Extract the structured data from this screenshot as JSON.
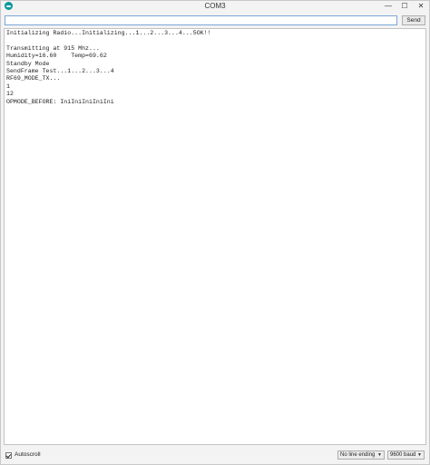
{
  "window": {
    "title": "COM3",
    "minimize_glyph": "—",
    "maximize_glyph": "☐",
    "close_glyph": "✕"
  },
  "input": {
    "value": "",
    "send_label": "Send"
  },
  "output": {
    "lines": [
      "Initializing Radio...Initializing...1...2...3...4...5OK!!",
      "",
      "Transmitting at 915 Mhz...",
      "Humidity=16.60    Temp=69.62",
      "Standby Mode",
      "SendFrame Test...1...2...3...4",
      "RF69_MODE_TX...",
      "1",
      "12",
      "OPMODE_BEFORE: IniIniIniIniIni"
    ]
  },
  "statusbar": {
    "autoscroll_label": "Autoscroll",
    "autoscroll_checked": true,
    "line_ending": "No line ending",
    "baud_rate": "9600 baud"
  },
  "icons": {
    "app": "arduino-icon",
    "dropdown": "chevron-down-icon"
  },
  "colors": {
    "app_icon": "#00979c"
  }
}
